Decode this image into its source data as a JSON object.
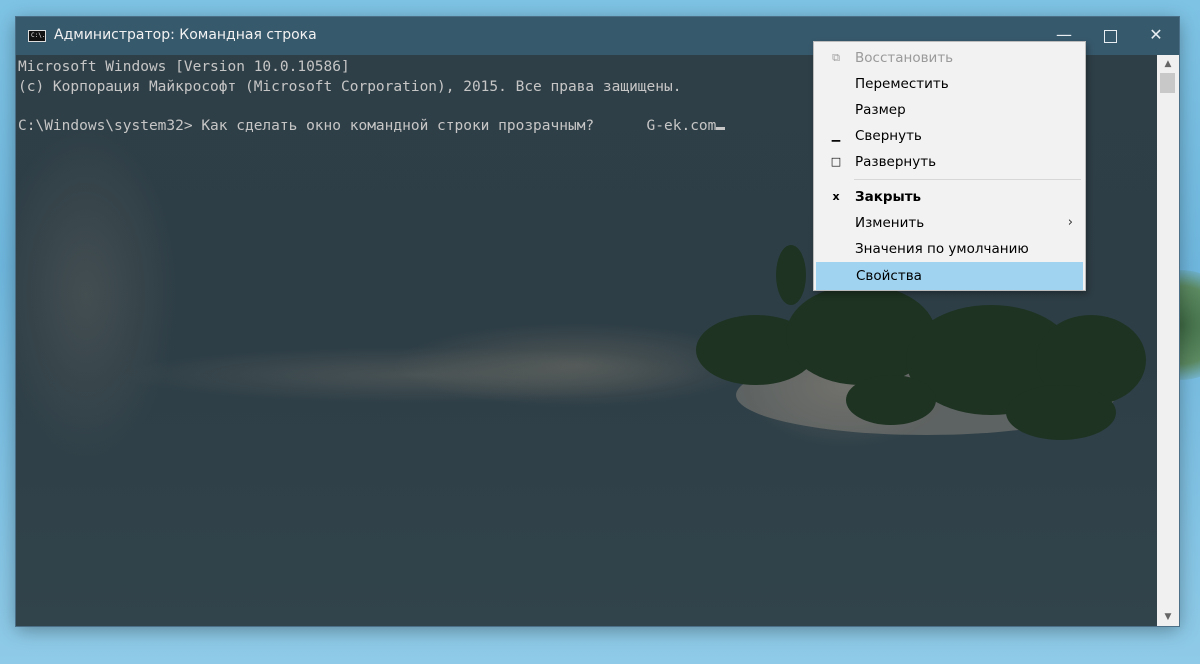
{
  "window": {
    "title": "Администратор: Командная строка",
    "icon_text": "C:\\.",
    "controls": {
      "minimize": "—",
      "maximize": "",
      "close": "✕"
    }
  },
  "console": {
    "line1": "Microsoft Windows [Version 10.0.10586]",
    "line2": "(c) Корпорация Майкрософт (Microsoft Corporation), 2015. Все права защищены.",
    "line3": "",
    "prompt": "C:\\Windows\\system32> Как сделать окно командной строки прозрачным?      G-ek.com"
  },
  "scrollbar": {
    "up": "▲",
    "down": "▼"
  },
  "context_menu": {
    "items": [
      {
        "label": "Восстановить",
        "icon": "restore-icon",
        "glyph": "⧉",
        "disabled": true
      },
      {
        "label": "Переместить",
        "icon": "",
        "glyph": ""
      },
      {
        "label": "Размер",
        "icon": "",
        "glyph": ""
      },
      {
        "label": "Свернуть",
        "icon": "minimize-icon",
        "glyph": "▁"
      },
      {
        "label": "Развернуть",
        "icon": "maximize-icon",
        "glyph": "□"
      },
      {
        "label": "Закрыть",
        "icon": "close-icon",
        "glyph": "x",
        "bold": true
      },
      {
        "label": "Изменить",
        "icon": "",
        "glyph": "",
        "submenu": "›"
      },
      {
        "label": "Значения по умолчанию",
        "icon": "",
        "glyph": ""
      },
      {
        "label": "Свойства",
        "icon": "",
        "glyph": "",
        "selected": true
      }
    ]
  },
  "colors": {
    "console_text": "#c6c6c6",
    "menu_highlight": "#9fd3f0",
    "titlebar": "#385c70"
  }
}
